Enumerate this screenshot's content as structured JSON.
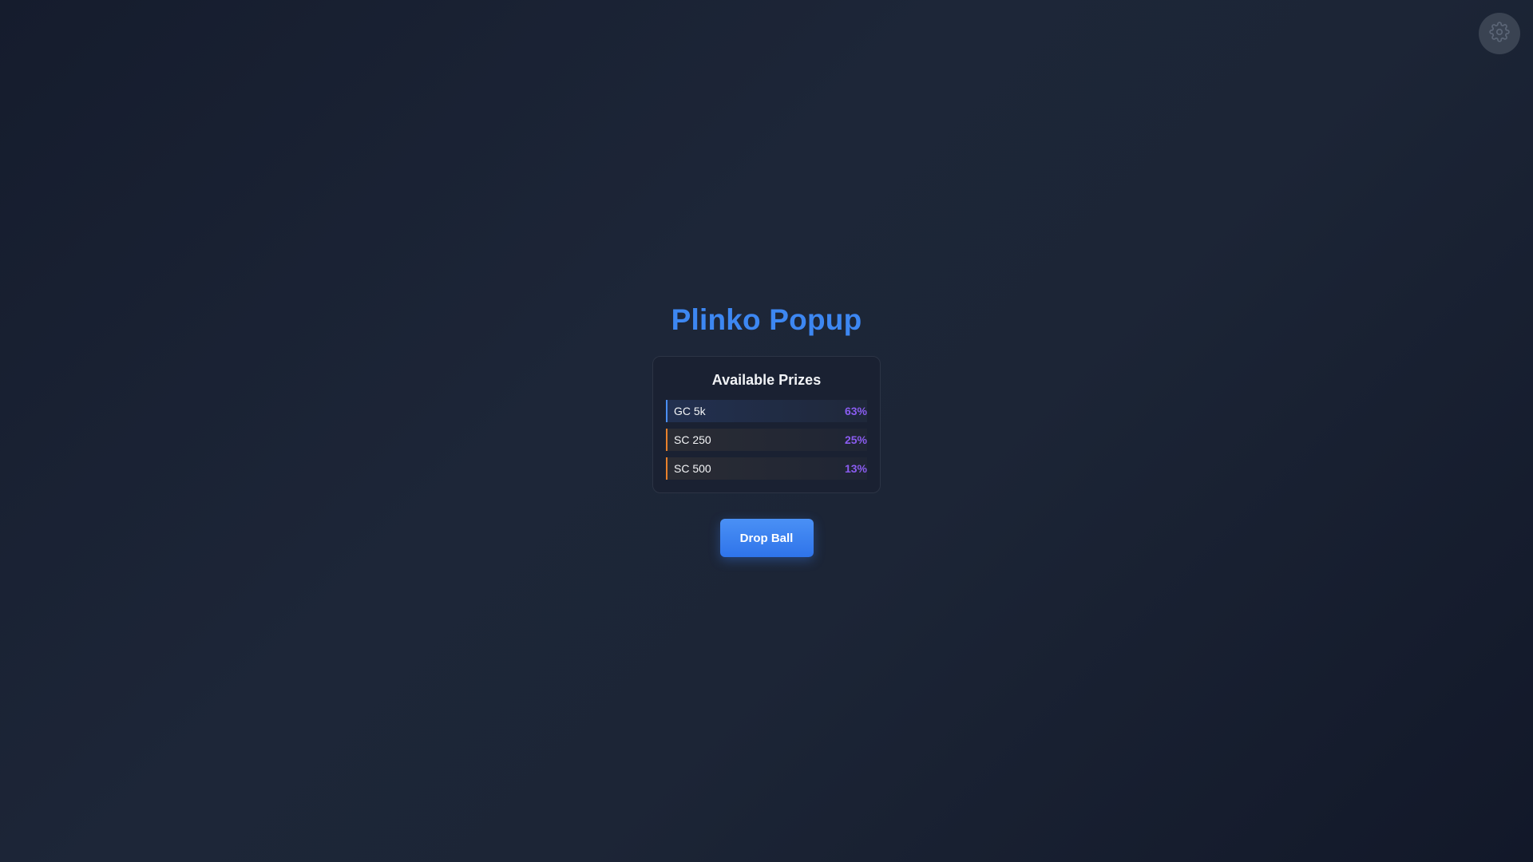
{
  "settings": {
    "icon": "gear-icon",
    "color": "#3a4352"
  },
  "title": "Plinko Popup",
  "prizes": {
    "heading": "Available Prizes",
    "items": [
      {
        "label": "GC 5k",
        "percent": "63%",
        "accent": "#4a8ff5"
      },
      {
        "label": "SC 250",
        "percent": "25%",
        "accent": "#e9812c"
      },
      {
        "label": "SC 500",
        "percent": "13%",
        "accent": "#e9812c"
      }
    ]
  },
  "actions": {
    "drop_label": "Drop Ball"
  },
  "colors": {
    "title": "#3d87f2",
    "percent": "#8a5cf0",
    "button": "#3b82f6"
  }
}
